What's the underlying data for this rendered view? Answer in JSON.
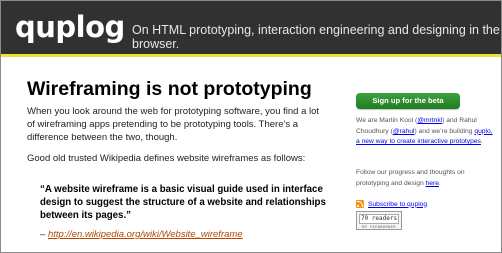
{
  "header": {
    "logo": "quplog",
    "tagline": "On HTML prototyping, interaction engineering and designing in the browser."
  },
  "article": {
    "title": "Wireframing is not prototyping",
    "paragraph1": "When you look around the web for prototyping software, you find a lot of wireframing apps pretending to be prototyping tools. There’s a difference between the two, though.",
    "paragraph2": "Good old trusted Wikipedia defines website wireframes as follows:",
    "quote": "“A website wireframe is a basic visual guide used in interface design to suggest the structure of a website and relationships between its pages.”",
    "cite_prefix": "– ",
    "cite_link": "http://en.wikipedia.org/wiki/Website_wireframe"
  },
  "sidebar": {
    "beta_button": "Sign up for the beta",
    "about_1": "We are Martin Kool (",
    "about_link_1": "@mrtnkl",
    "about_2": ") and Rahul Choudhury (",
    "about_link_2": "@rahul",
    "about_3": ") and we’re building ",
    "about_link_3": "quplo, a new way to create interactive prototypes",
    "about_4": ".",
    "follow_1": "Follow our progress and thoughts on prototyping and design ",
    "follow_link": "here",
    "follow_2": ".",
    "subscribe_link": "Subscribe to quplog",
    "feed_count": "70 readers",
    "feed_by": "BY FEEDBURNER"
  },
  "colors": {
    "header_bg": "#313131",
    "header_accent": "#f0e03a",
    "button_green": "#2e8b2e",
    "link": "#b34700"
  }
}
